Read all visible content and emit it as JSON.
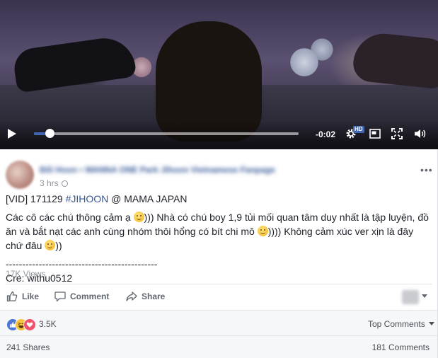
{
  "video": {
    "time_remaining": "-0:02",
    "hd_label": "HD",
    "progress": 0.06
  },
  "post": {
    "author": "Bối Hoon • WANNA ONE Park Jihoon Vietnamese Fanpage",
    "time": "3 hrs",
    "line1_prefix": "[VID] 171129 ",
    "hashtag": "#JIHOON",
    "line1_suffix": " @ MAMA JAPAN",
    "para2_a": "Các cô các chú thông cảm ạ ",
    "para2_b": "))) Nhà có chú boy 1,9 tủi mối quan tâm duy nhất là tập luyện, đồ ăn và bắt nạt các anh cùng nhóm thôi hổng có bít chi mô ",
    "para2_c": ")))) Không cảm xúc ver xịn là đây chứ đâu ",
    "para2_d": "))",
    "separator": "----------------------------------------------",
    "credit": "Cre: withu0512",
    "views": "17K Views"
  },
  "actions": {
    "like": "Like",
    "comment": "Comment",
    "share": "Share"
  },
  "stats": {
    "reactions": "3.5K",
    "top_comments": "Top Comments",
    "shares": "241 Shares",
    "comments": "181 Comments"
  },
  "colors": {
    "link": "#365899",
    "accent": "#4267b2",
    "muted": "#90949c"
  },
  "icons": [
    "play-icon",
    "gear-icon",
    "pip-icon",
    "fullscreen-icon",
    "volume-icon",
    "globe-icon",
    "more-icon",
    "like-icon",
    "comment-icon",
    "share-icon",
    "like-reaction-icon",
    "haha-reaction-icon",
    "love-reaction-icon"
  ]
}
